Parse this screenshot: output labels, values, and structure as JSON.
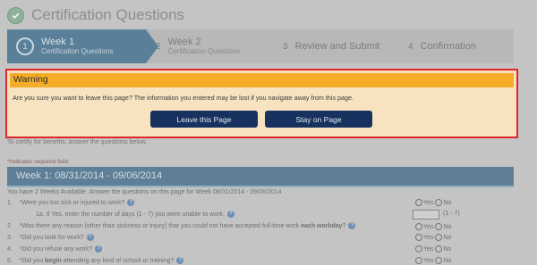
{
  "header": {
    "title": "Certification Questions"
  },
  "steps": [
    {
      "number": "1",
      "label": "Week 1",
      "sublabel": "Certification Questions"
    },
    {
      "number": "2",
      "label": "Week 2",
      "sublabel": "Certification Questions"
    },
    {
      "number": "3",
      "label": "Review and Submit",
      "sublabel": ""
    },
    {
      "number": "4",
      "label": "Confirmation",
      "sublabel": ""
    }
  ],
  "modal": {
    "title": "Warning",
    "message": "Are you sure you want to leave this page? The information you entered may be lost if you navigate away from this page.",
    "leave_label": "Leave this Page",
    "stay_label": "Stay on Page"
  },
  "form": {
    "intro": "To certify for benefits, answer the questions below.",
    "required_note": "*Indicates required field",
    "week_title": "Week 1: 08/31/2014 - 09/06/2014",
    "available": "You have 2 Weeks Available. Answer the questions on this page for Week 08/31/2014 - 09/06/2014",
    "q1": {
      "num": "1.",
      "text": "*Were you too sick or injured to work?"
    },
    "q1a": {
      "text": "1a. If Yes, enter the number of days (1 - 7) you were unable to work."
    },
    "q1a_range": "(1 - 7)",
    "q2": {
      "num": "2.",
      "text": "*Was there any reason (other than sickness or injury) that you could not have accepted full-time work ",
      "bold": "each workday",
      "end": "?"
    },
    "q3": {
      "num": "3.",
      "text": "*Did you look for work?"
    },
    "q4": {
      "num": "4.",
      "text": "*Did you refuse any work?"
    },
    "q5": {
      "num": "5.",
      "text": "*Did you ",
      "bold": "begin",
      "end": " attending any kind of school or training?"
    },
    "yes": "Yes",
    "no": "No"
  }
}
